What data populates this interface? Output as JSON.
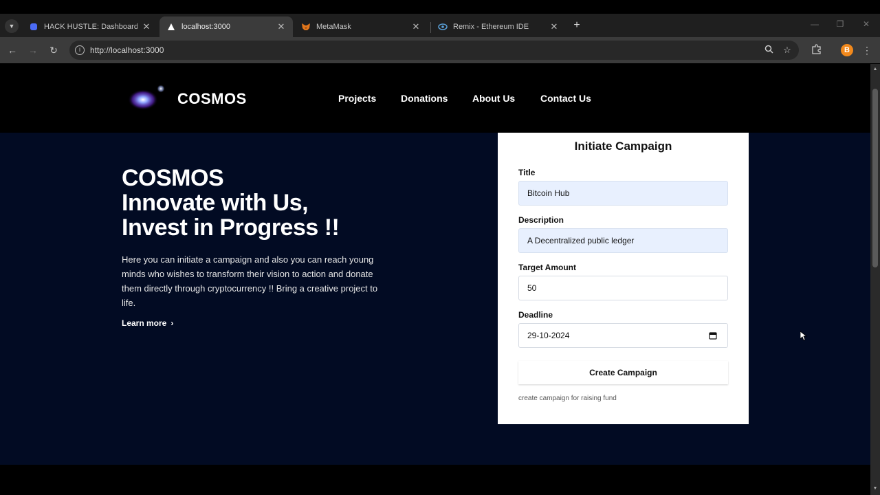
{
  "browser": {
    "tabs": [
      {
        "title": "HACK HUSTLE: Dashboard | Dev",
        "favicon": "devfolio-icon"
      },
      {
        "title": "localhost:3000",
        "favicon": "nextjs-icon",
        "active": true
      },
      {
        "title": "MetaMask",
        "favicon": "metamask-fox-icon"
      },
      {
        "title": "Remix - Ethereum IDE",
        "favicon": "remix-icon"
      }
    ],
    "url": "http://localhost:3000",
    "extension_badge": "B"
  },
  "site": {
    "brand": "COSMOS",
    "nav": [
      "Projects",
      "Donations",
      "About Us",
      "Contact Us"
    ]
  },
  "hero": {
    "title_lines": [
      "COSMOS",
      "Innovate with Us,",
      "Invest in Progress !!"
    ],
    "description": "Here you can initiate a campaign and also you can reach young minds who wishes to transform their vision to action and donate them directly through cryptocurrency !! Bring a creative project to life.",
    "learn_more": "Learn more",
    "learn_more_icon": "chevron-right-icon"
  },
  "form": {
    "heading": "Initiate Campaign",
    "title_label": "Title",
    "title_value": "Bitcoin Hub",
    "description_label": "Description",
    "description_value": "A Decentralized public ledger",
    "target_label": "Target Amount",
    "target_value": "50",
    "deadline_label": "Deadline",
    "deadline_value": "29-10-2024",
    "submit_label": "Create Campaign",
    "note": "create campaign for raising fund"
  },
  "colors": {
    "page_background": "#020b23",
    "header_background": "#000000",
    "autofill_background": "#e8f0fe",
    "card_background": "#ffffff"
  }
}
